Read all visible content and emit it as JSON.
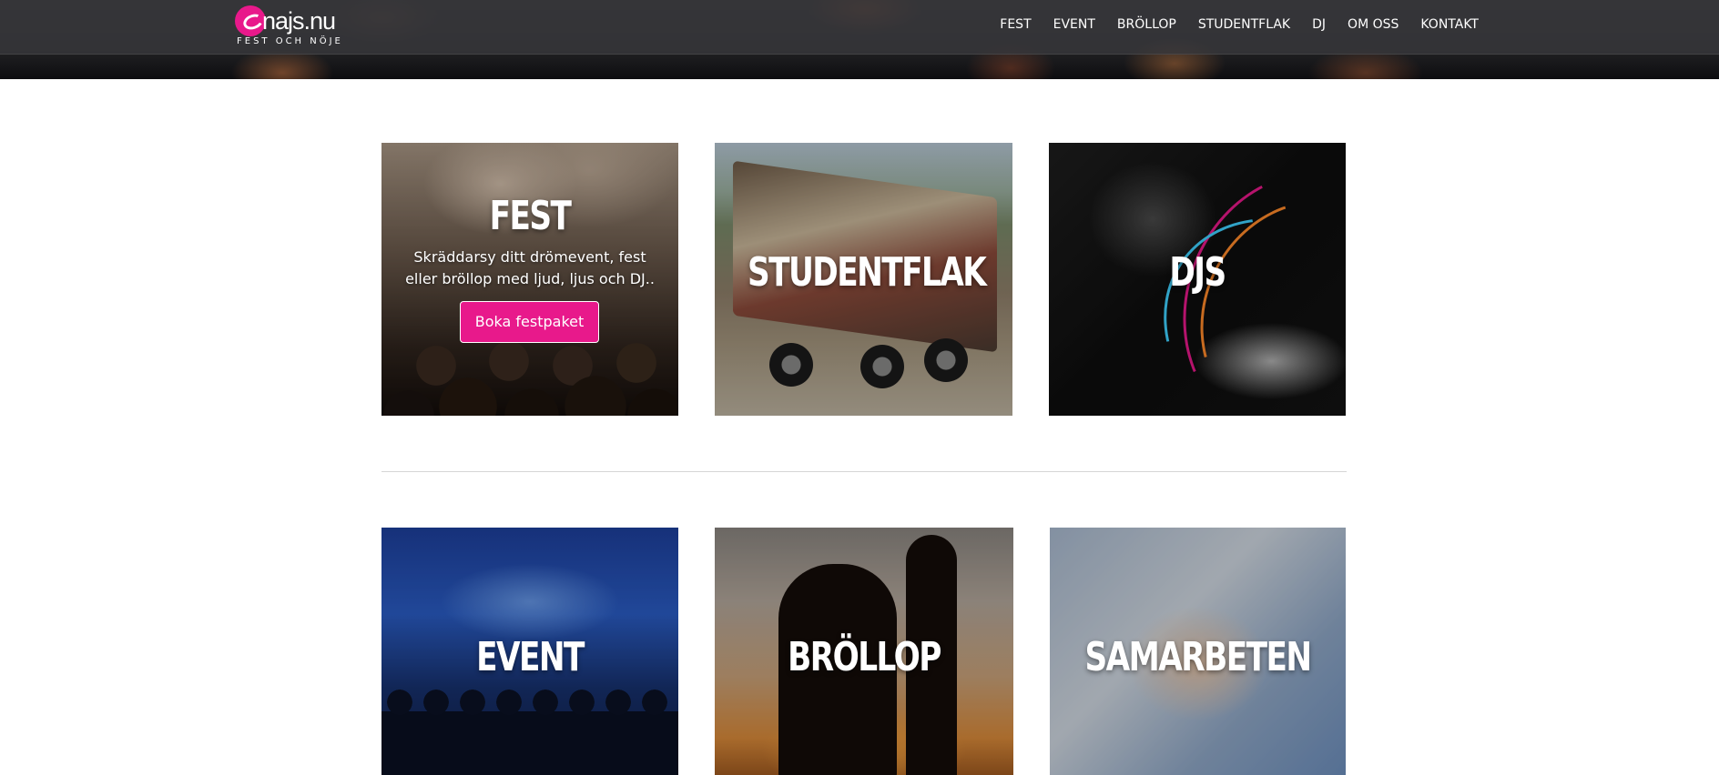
{
  "header": {
    "logo_text": "najs.nu",
    "logo_tagline": "FEST OCH NÖJE",
    "nav": [
      {
        "label": "FEST"
      },
      {
        "label": "EVENT"
      },
      {
        "label": "BRÖLLOP"
      },
      {
        "label": "STUDENTFLAK"
      },
      {
        "label": "DJ"
      },
      {
        "label": "OM OSS"
      },
      {
        "label": "KONTAKT"
      }
    ]
  },
  "tiles": {
    "fest": {
      "title": "FEST",
      "description": "Skräddarsy ditt drömevent, fest eller bröllop med ljud, ljus och DJ..",
      "button_label": "Boka festpaket"
    },
    "studentflak": {
      "title": "STUDENTFLAK"
    },
    "djs": {
      "title": "DJS"
    },
    "event": {
      "title": "EVENT"
    },
    "brollop": {
      "title": "BRÖLLOP"
    },
    "samarbeten": {
      "title": "SAMARBETEN"
    }
  },
  "colors": {
    "accent": "#e8198b",
    "header_bg": "#37373a",
    "divider": "#d6d6d6"
  }
}
